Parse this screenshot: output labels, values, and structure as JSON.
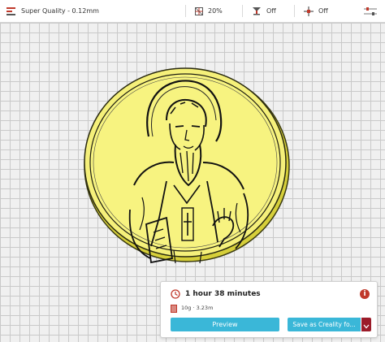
{
  "topbar": {
    "profile_label": "Super Quality - 0.12mm",
    "infill_value": "20%",
    "support_value": "Off",
    "adhesion_value": "Off",
    "icons": [
      "profile-icon",
      "infill-icon",
      "support-icon",
      "adhesion-icon",
      "settings-sliders-icon"
    ]
  },
  "action_panel": {
    "print_time": "1 hour 38 minutes",
    "material_usage": "10g · 3.23m",
    "preview_label": "Preview",
    "save_label": "Save as Creality fo...",
    "colors": {
      "button": "#3ab7d8",
      "dropdown": "#9b1c2a",
      "info": "#c0392b"
    }
  },
  "model": {
    "color": "#f5f07a",
    "outline_color": "#111111"
  }
}
